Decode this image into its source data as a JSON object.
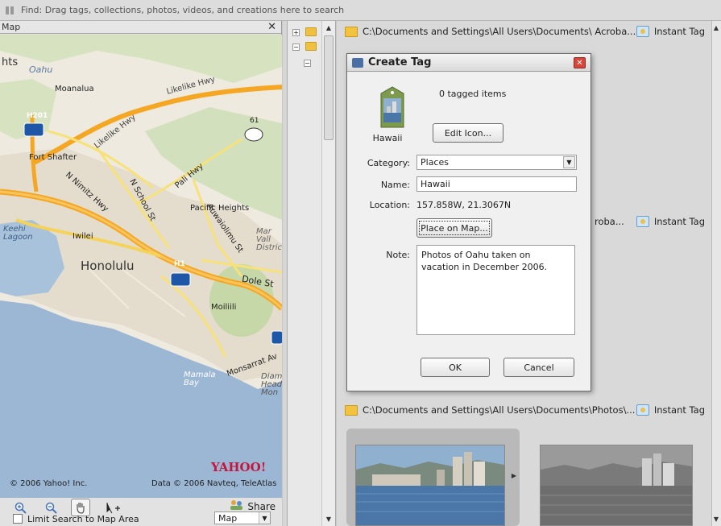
{
  "findbar": {
    "text": "Find: Drag tags, collections, photos, videos, and creations here to search"
  },
  "map": {
    "title": "Map",
    "close": "✕",
    "labels": {
      "oahu": "Oahu",
      "moanalua": "Moanalua",
      "likelike_hwy": "Likelike Hwy",
      "likelike_hwy2": "Likelike Hwy",
      "h201": "H201",
      "route61": "61",
      "fort_shafter": "Fort Shafter",
      "nimitz_hwy": "N Nimitz Hwy",
      "n_school_st": "N School St",
      "pali_hwy": "Pali Hwy",
      "pacific_heights": "Pacific Heights",
      "keehi_lagoon": "Keehi Lagoon",
      "iwilei": "Iwilei",
      "honolulu": "Honolulu",
      "auwaiolimu": "Auwaiolimu St",
      "mar_vall": "Mar Vall Distric",
      "h1": "H1",
      "dole_st": "Dole St",
      "moiliili": "Moiliili",
      "mamala_bay": "Mamala Bay",
      "monsarrat": "Monsarrat Av",
      "diamond_head": "Diam Head Mon",
      "hts": "hts",
      "yahoo": "YAHOO!",
      "copyright_left": "© 2006 Yahoo! Inc.",
      "copyright_right": "Data © 2006 Navteq, TeleAtlas"
    },
    "share_label": "Share",
    "limit_label": "Limit Search to Map Area",
    "view_select": "Map"
  },
  "groups": [
    {
      "path": "C:\\Documents and Settings\\All Users\\Documents\\ Acroba...",
      "instant": "Instant Tag"
    },
    {
      "path": "roba...",
      "instant": "Instant Tag"
    },
    {
      "path": "C:\\Documents and Settings\\All Users\\Documents\\Photos\\...",
      "instant": "Instant Tag"
    }
  ],
  "dialog": {
    "title": "Create Tag",
    "close": "✕",
    "tagged_items": "0 tagged items",
    "tag_name_caption": "Hawaii",
    "edit_icon": "Edit Icon...",
    "category_label": "Category:",
    "category_value": "Places",
    "name_label": "Name:",
    "name_value": "Hawaii",
    "location_label": "Location:",
    "location_value": "157.858W, 21.3067N",
    "place_on_map": "Place on Map...",
    "note_label": "Note:",
    "note_value": "Photos of Oahu taken on vacation in December 2006.",
    "ok": "OK",
    "cancel": "Cancel"
  },
  "colors": {
    "road_major": "#f5a623",
    "road_minor": "#f7e27a",
    "water": "#9bb7d4",
    "land": "#efeadf",
    "park": "#c9dbb0",
    "urban": "#e0d9cc"
  }
}
